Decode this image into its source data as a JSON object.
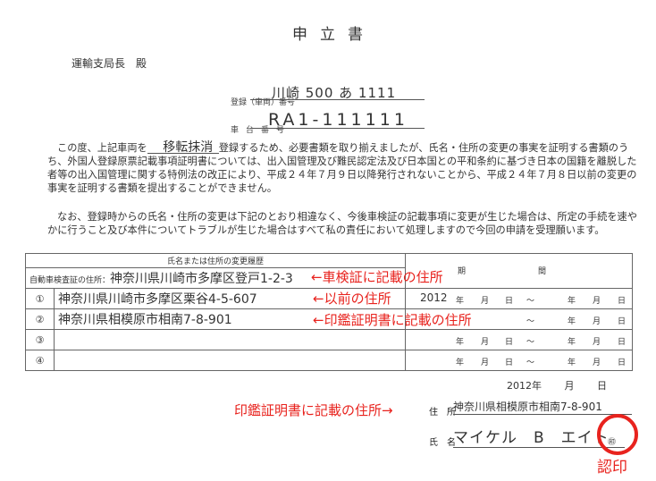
{
  "document": {
    "title": "申立書",
    "addressee": "運輸支局長　殿",
    "registration": {
      "label": "登録（車両）番号",
      "value": "川崎 500 あ 1111"
    },
    "chassis": {
      "label": "車台番号",
      "value": "RA1-111111"
    },
    "paragraph1": {
      "before": "この度、上記車両を",
      "filled": "移転抹消",
      "after": "登録するため、必要書類を取り揃えましたが、氏名・住所の変更の事実を証明する書類のうち、外国人登録原票記載事項証明書については、出入国管理及び難民認定法及び日本国との平和条約に基づき日本の国籍を離脱した者等の出入国管理に関する特例法の改正により、平成２４年７月９日以降発行されないことから、平成２４年７月８日以前の変更の事実を証明する書類を提出することができません。"
    },
    "paragraph2": "なお、登録時からの氏名・住所の変更は下記のとおり相違なく、今後車検証の記載事項に変更が生じた場合は、所定の手続を速やかに行うこと及び本件についてトラブルが生じた場合はすべて私の責任において処理しますので今回の申請を受理願います。"
  },
  "history_table": {
    "header": "氏名または住所の変更履歴",
    "period_header": [
      "期",
      "間"
    ],
    "inspection_label": "自動車検査証の住所：",
    "inspection_address": "神奈川県川崎市多摩区登戸1-2-3",
    "period_units": {
      "year": "年",
      "month": "月",
      "day": "日",
      "tilde": "～"
    },
    "rows": [
      {
        "num": "①",
        "address": "神奈川県川崎市多摩区栗谷4-5-607",
        "from_year": "2012"
      },
      {
        "num": "②",
        "address": "神奈川県相模原市相南7-8-901",
        "from_year": ""
      },
      {
        "num": "③",
        "address": "",
        "from_year": ""
      },
      {
        "num": "④",
        "address": "",
        "from_year": ""
      }
    ]
  },
  "annotations": {
    "inspection": "←車検証に記載の住所",
    "previous": "←以前の住所",
    "seal_cert": "←印鑑証明書に記載の住所",
    "seal_cert_arrow_right": "印鑑証明書に記載の住所→",
    "seal": "認印",
    "accent_color": "#e8231e"
  },
  "signature": {
    "date": {
      "year": "2012",
      "year_unit": "年",
      "month_unit": "月",
      "day_unit": "日"
    },
    "address_label": "住　所",
    "address_value": "神奈川県相模原市相南7-8-901",
    "name_label": "氏　名",
    "name_value": "マイケル　B　エイト",
    "seal_mark": "㊞"
  }
}
